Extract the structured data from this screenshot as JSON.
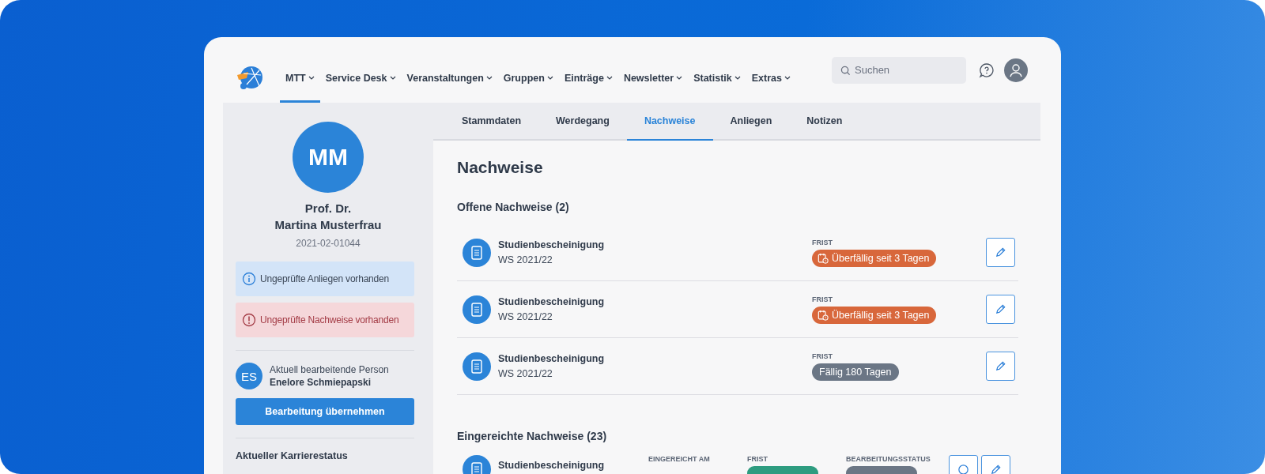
{
  "nav": {
    "items": [
      {
        "label": "MTT",
        "selected": true
      },
      {
        "label": "Service Desk",
        "selected": false
      },
      {
        "label": "Veranstaltungen",
        "selected": false
      },
      {
        "label": "Gruppen",
        "selected": false
      },
      {
        "label": "Einträge",
        "selected": false
      },
      {
        "label": "Newsletter",
        "selected": false
      },
      {
        "label": "Statistik",
        "selected": false
      },
      {
        "label": "Extras",
        "selected": false
      }
    ],
    "search": {
      "placeholder": "Suchen"
    }
  },
  "profile": {
    "initials": "MM",
    "title": "Prof. Dr.",
    "name": "Martina Musterfrau",
    "id": "2021-02-01044",
    "alerts": [
      {
        "kind": "info",
        "text": "Ungeprüfte Anliegen vorhanden"
      },
      {
        "kind": "error",
        "text": "Ungeprüfte Nachweise vorhanden"
      }
    ],
    "editor": {
      "initials": "ES",
      "label": "Aktuell bearbeitende Person",
      "name": "Enelore Schmiepapski"
    },
    "button": "Bearbeitung übernehmen",
    "section_title": "Aktueller Karrierestatus"
  },
  "tabs": [
    {
      "label": "Stammdaten",
      "selected": false
    },
    {
      "label": "Werdegang",
      "selected": false
    },
    {
      "label": "Nachweise",
      "selected": true
    },
    {
      "label": "Anliegen",
      "selected": false
    },
    {
      "label": "Notizen",
      "selected": false
    }
  ],
  "page_title": "Nachweise",
  "open": {
    "title": "Offene Nachweise (2)",
    "rows": [
      {
        "name": "Studienbescheinigung",
        "term": "WS 2021/22",
        "deadline_label": "FRIST",
        "badge": {
          "kind": "overdue",
          "text": "Überfällig seit 3 Tagen"
        }
      },
      {
        "name": "Studienbescheinigung",
        "term": "WS 2021/22",
        "deadline_label": "FRIST",
        "badge": {
          "kind": "overdue",
          "text": "Überfällig seit 3 Tagen"
        }
      },
      {
        "name": "Studienbescheinigung",
        "term": "WS 2021/22",
        "deadline_label": "FRIST",
        "badge": {
          "kind": "due",
          "text": "Fällig 180 Tagen"
        }
      }
    ]
  },
  "submitted": {
    "title": "Eingereichte Nachweise (23)",
    "rows": [
      {
        "name": "Studienbescheinigung",
        "submitted_label": "EINGEREICHT AM",
        "deadline_label": "FRIST",
        "status_label": "BEARBEITUNGSSTATUS"
      }
    ]
  }
}
